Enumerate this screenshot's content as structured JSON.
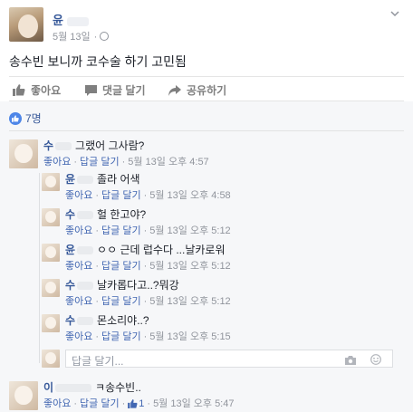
{
  "post": {
    "author": "윤",
    "date": "5월 13일",
    "date_sep": "·",
    "text": "송수빈 보니까 코수술 하기 고민됨"
  },
  "actions": {
    "like": "좋아요",
    "comment": "댓글 달기",
    "share": "공유하기"
  },
  "reactions": {
    "count": "7명"
  },
  "comment_meta": {
    "like": "좋아요",
    "reply": "답글 달기",
    "sep": "·"
  },
  "comments": [
    {
      "name": "수",
      "text": "그랬어 그사람?",
      "time": "5월 13일 오후 4:57"
    },
    {
      "name": "윤",
      "text": "졸라 어색",
      "time": "5월 13일 오후 4:58"
    },
    {
      "name": "수",
      "text": "헐 한고야?",
      "time": "5월 13일 오후 5:12"
    },
    {
      "name": "윤",
      "text": "ㅇㅇ 근데 럽수다 ...날카로워",
      "time": "5월 13일 오후 5:12"
    },
    {
      "name": "수",
      "text": "날카롭다고..?뭐강",
      "time": "5월 13일 오후 5:12"
    },
    {
      "name": "수",
      "text": "몬소리야..?",
      "time": "5월 13일 오후 5:15"
    },
    {
      "name": "이",
      "text": "ㅋ송수빈..",
      "time": "5월 13일 오후 5:47",
      "likes": "1"
    }
  ],
  "reply_input": {
    "placeholder": "답글 달기..."
  },
  "colors": {
    "link": "#365899",
    "meta": "#90949c",
    "panel": "#f6f7f9",
    "like_blue": "#4e86e8"
  }
}
